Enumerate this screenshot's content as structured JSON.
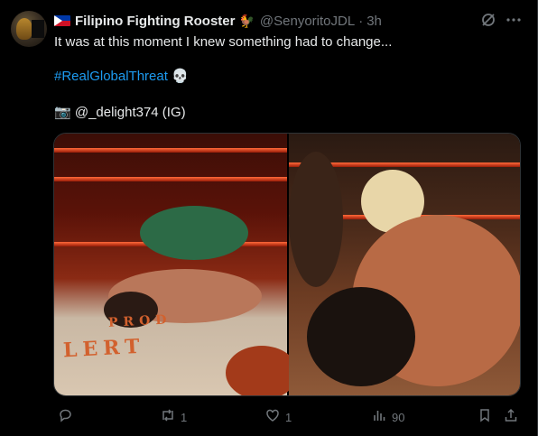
{
  "author": {
    "name": "Filipino Fighting Rooster",
    "name_emoji": "🐓",
    "handle": "@SenyoritoJDL",
    "separator": "·",
    "time": "3h"
  },
  "tweet": {
    "line1": "It was at this moment I knew something had to change...",
    "hashtag": "#RealGlobalThreat",
    "hashtag_emoji": "💀",
    "credit": "📷 @_delight374 (IG)"
  },
  "media": {
    "left_canvas_text": "LERT",
    "left_canvas_text2": "PROD"
  },
  "actions": {
    "reply_count": "",
    "repost_count": "1",
    "like_count": "1",
    "views_count": "90"
  },
  "icons": {
    "grok": "grok-icon",
    "more": "more-icon",
    "reply": "reply-icon",
    "repost": "repost-icon",
    "like": "heart-icon",
    "views": "views-icon",
    "bookmark": "bookmark-icon",
    "share": "share-icon"
  },
  "colors": {
    "background": "#000000",
    "text": "#e7e9ea",
    "muted": "#71767b",
    "link": "#1d9bf0"
  }
}
